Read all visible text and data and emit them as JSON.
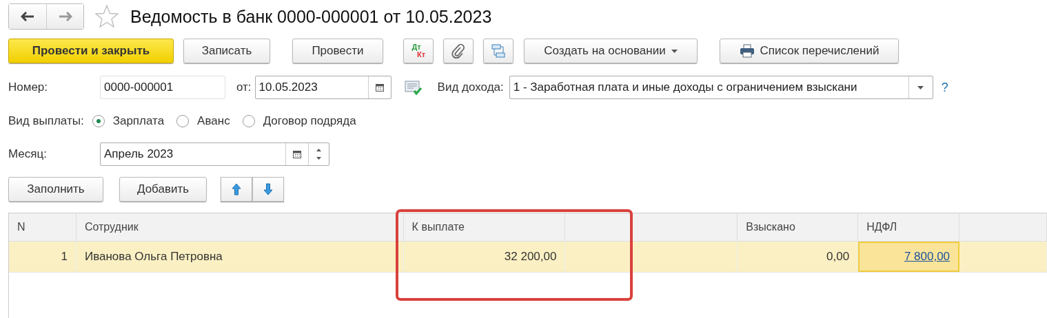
{
  "window": {
    "title": "Ведомость в банк 0000-000001 от 10.05.2023",
    "favorite": false
  },
  "toolbar": [
    {
      "kind": "primary",
      "label": "Провести и закрыть"
    },
    {
      "kind": "button",
      "label": "Записать"
    },
    {
      "kind": "button",
      "label": "Провести"
    },
    {
      "kind": "dtkt",
      "label": "Дт",
      "label2": "Кт"
    },
    {
      "kind": "clip"
    },
    {
      "kind": "structure"
    },
    {
      "kind": "menu",
      "label": "Создать на основании"
    },
    {
      "kind": "print",
      "label": "Список перечислений"
    }
  ],
  "number": {
    "label": "Номер:",
    "value": "0000-000001"
  },
  "date": {
    "label": "от:",
    "value": "10.05.2023"
  },
  "income_type": {
    "label": "Вид дохода:",
    "value": "1 - Заработная плата и иные доходы с ограничением взыскани",
    "help": "?"
  },
  "payment_type": {
    "label": "Вид выплаты:",
    "options": [
      {
        "label": "Зарплата",
        "selected": true
      },
      {
        "label": "Аванс",
        "selected": false
      },
      {
        "label": "Договор подряда",
        "selected": false
      }
    ]
  },
  "month": {
    "label": "Месяц:",
    "value": "Апрель 2023"
  },
  "table_buttons": [
    {
      "kind": "button",
      "label": "Заполнить"
    },
    {
      "kind": "button",
      "label": "Добавить"
    },
    {
      "kind": "arrows"
    }
  ],
  "table": {
    "columns": [
      "N",
      "Сотрудник",
      "К выплате",
      "",
      "Взыскано",
      "НДФЛ",
      ""
    ],
    "rows": [
      {
        "selected": true,
        "cells": [
          {
            "text": "1",
            "kind": "number",
            "current": false
          },
          {
            "text": "Иванова Ольга Петровна",
            "kind": "text",
            "current": false
          },
          {
            "text": "32 200,00",
            "kind": "number",
            "current": false
          },
          {
            "text": "",
            "kind": "text",
            "current": false
          },
          {
            "text": "0,00",
            "kind": "number",
            "current": false
          },
          {
            "text": "7 800,00",
            "kind": "link",
            "current": true
          },
          {
            "text": "",
            "kind": "text",
            "current": false
          }
        ]
      }
    ]
  },
  "annotation": {
    "kind": "frame",
    "color": "#d9413c"
  }
}
